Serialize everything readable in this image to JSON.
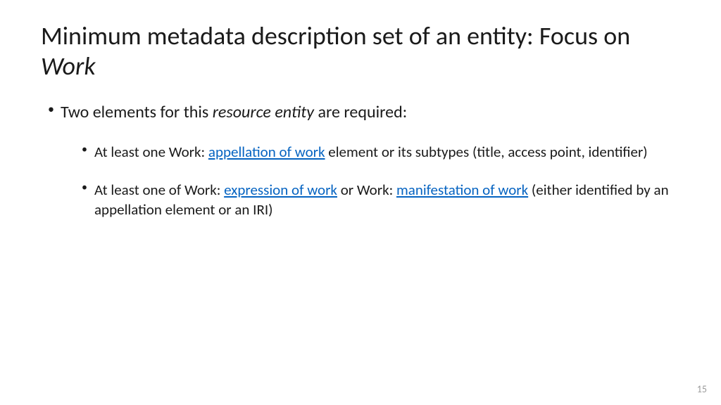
{
  "title_part1": "Minimum metadata description set of an entity: Focus on ",
  "title_italic": "Work",
  "bullet1_pre": "Two elements for this ",
  "bullet1_italic": "resource entity",
  "bullet1_post": " are required:",
  "sub1_pre": "At least one Work: ",
  "sub1_link": "appellation of work",
  "sub1_post": " element or its subtypes (title, access point, identifier)",
  "sub2_pre": "At least one of Work: ",
  "sub2_link1": "expression of work",
  "sub2_mid": " or Work: ",
  "sub2_link2": "manifestation of work",
  "sub2_post": " (either identified by an appellation element or an IRI)",
  "page_number": "15"
}
